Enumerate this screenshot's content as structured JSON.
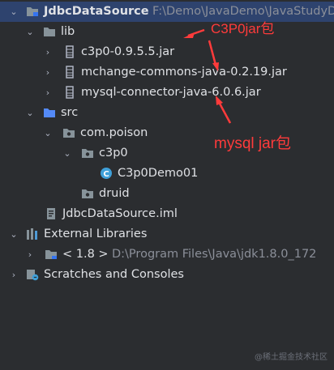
{
  "tree": {
    "project": {
      "name": "JdbcDataSource",
      "path": "F:\\Demo\\JavaDemo\\JavaStudyD"
    },
    "lib": {
      "label": "lib"
    },
    "jars": [
      {
        "label": "c3p0-0.9.5.5.jar"
      },
      {
        "label": "mchange-commons-java-0.2.19.jar"
      },
      {
        "label": "mysql-connector-java-6.0.6.jar"
      }
    ],
    "src": {
      "label": "src"
    },
    "package": {
      "label": "com.poison"
    },
    "c3p0_folder": {
      "label": "c3p0"
    },
    "class_file": {
      "label": "C3p0Demo01"
    },
    "druid_folder": {
      "label": "druid"
    },
    "iml": {
      "label": "JdbcDataSource.iml"
    },
    "external_libraries": {
      "label": "External Libraries"
    },
    "jdk": {
      "version": "< 1.8 >",
      "path": "D:\\Program Files\\Java\\jdk1.8.0_172"
    },
    "scratches": {
      "label": "Scratches and Consoles"
    }
  },
  "annotations": {
    "c3p0_note": "C3P0jar包",
    "mysql_note": "mysql jar包",
    "color": "#ff3b3b"
  },
  "watermark": "@稀土掘金技术社区"
}
